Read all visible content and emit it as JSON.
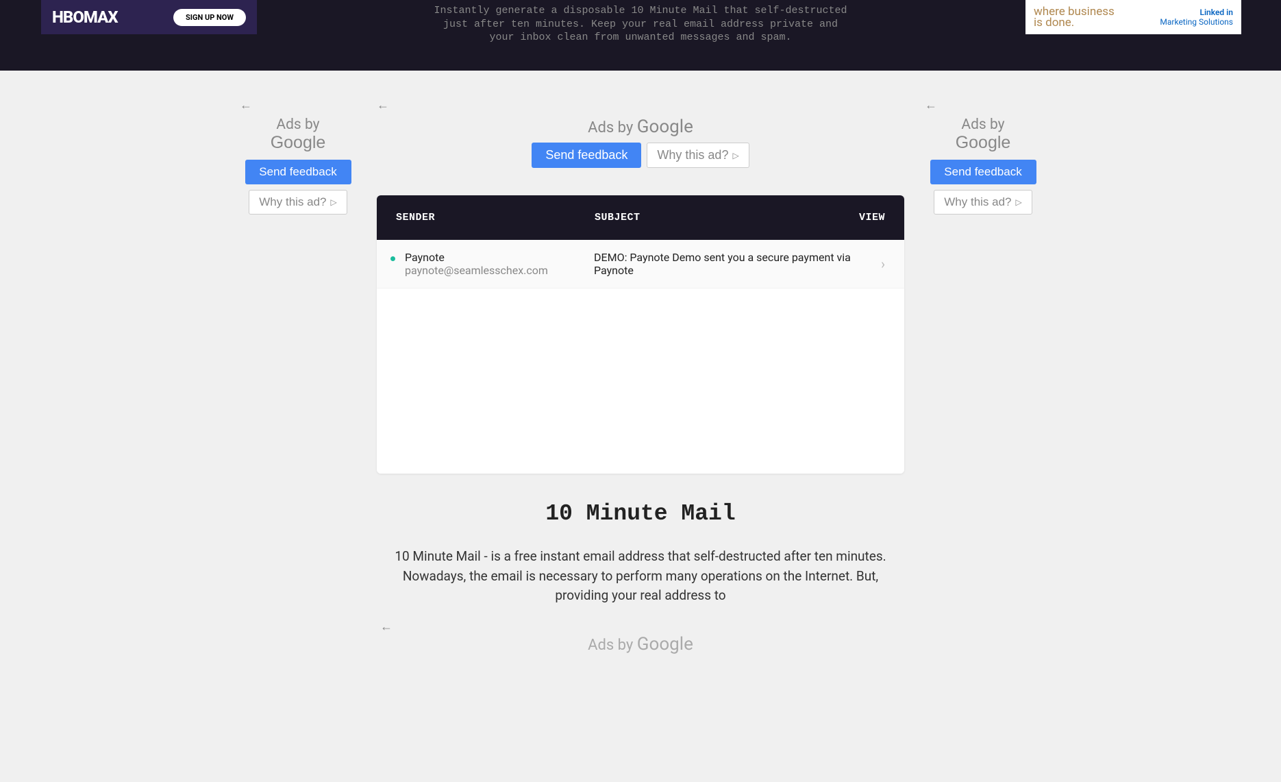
{
  "header": {
    "hbo": {
      "logo": "HBOMAX",
      "button": "SIGN UP NOW"
    },
    "description": "Instantly generate a disposable 10 Minute Mail that self-destructed just after ten minutes. Keep your real email address private and your inbox clean from unwanted messages and spam.",
    "linkedin": {
      "text": "where business\nis done.",
      "brand_top": "Linked in",
      "brand_bottom": "Marketing Solutions"
    }
  },
  "ads": {
    "title_prefix": "Ads by",
    "title_brand": "Google",
    "send_feedback": "Send feedback",
    "why_this_ad": "Why this ad?"
  },
  "inbox": {
    "headers": {
      "sender": "SENDER",
      "subject": "SUBJECT",
      "view": "VIEW"
    },
    "messages": [
      {
        "sender_name": "Paynote",
        "sender_email": "paynote@seamlesschex.com",
        "subject": "DEMO: Paynote Demo sent you a secure payment via Paynote"
      }
    ]
  },
  "article": {
    "title": "10 Minute Mail",
    "body": "10 Minute Mail - is a free instant email address that self-destructed after ten minutes. Nowadays, the email is necessary to perform many operations on the Internet. But, providing your real address to"
  }
}
